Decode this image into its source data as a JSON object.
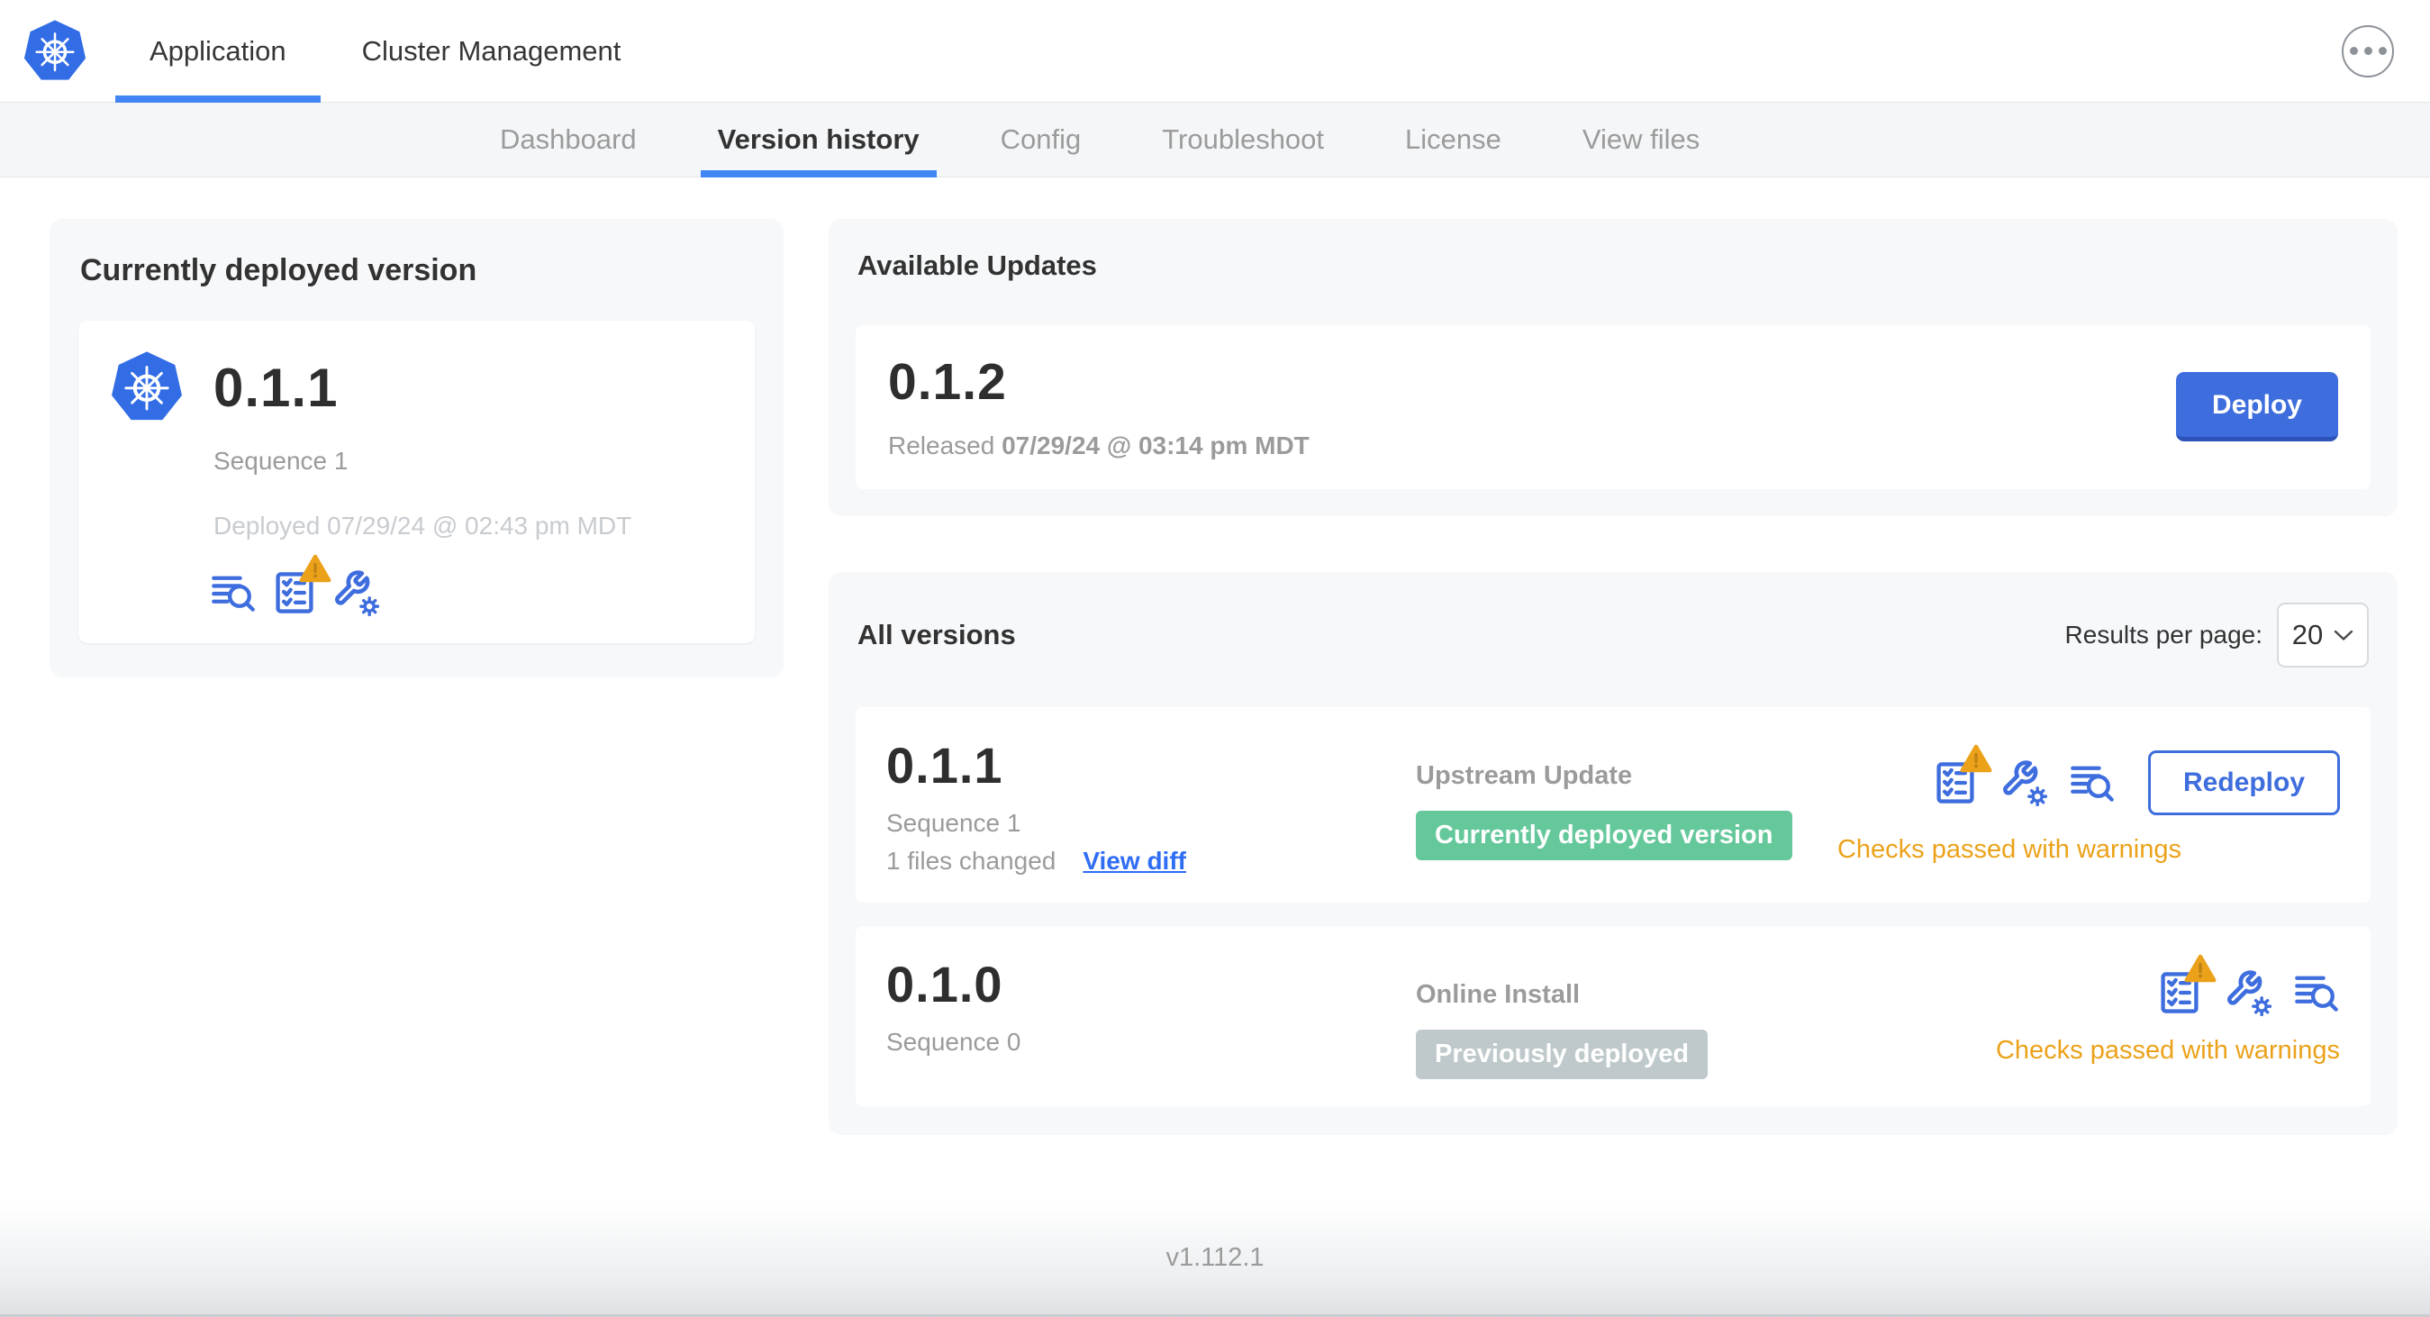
{
  "header": {
    "tabs": [
      {
        "label": "Application"
      },
      {
        "label": "Cluster Management"
      }
    ]
  },
  "subnav": {
    "tabs": [
      {
        "label": "Dashboard"
      },
      {
        "label": "Version history"
      },
      {
        "label": "Config"
      },
      {
        "label": "Troubleshoot"
      },
      {
        "label": "License"
      },
      {
        "label": "View files"
      }
    ]
  },
  "current_version": {
    "title": "Currently deployed version",
    "version": "0.1.1",
    "sequence": "Sequence 1",
    "deployed": "Deployed 07/29/24 @ 02:43 pm MDT"
  },
  "available_updates": {
    "title": "Available Updates",
    "version": "0.1.2",
    "released_label": "Released",
    "released_date": "07/29/24 @ 03:14 pm MDT",
    "deploy_label": "Deploy"
  },
  "all_versions": {
    "title": "All versions",
    "results_per_page_label": "Results per page:",
    "results_per_page": "20",
    "rows": [
      {
        "version": "0.1.1",
        "sequence": "Sequence 1",
        "files_changed": "1 files changed",
        "view_diff_label": "View diff",
        "source": "Upstream Update",
        "badge": "Currently deployed version",
        "status": "Checks passed with warnings",
        "action_label": "Redeploy"
      },
      {
        "version": "0.1.0",
        "sequence": "Sequence 0",
        "source": "Online Install",
        "badge": "Previously deployed",
        "status": "Checks passed with warnings"
      }
    ]
  },
  "footer": {
    "app_version": "v1.112.1"
  },
  "colors": {
    "accent_blue": "#3e6dde",
    "active_tab_underline": "#4285f4",
    "k8s_logo_blue": "#326de6",
    "badge_green_bg": "#65c89b",
    "badge_gray_bg": "#bfc9cc",
    "warning_amber": "#eba21a",
    "text_dark": "#323232",
    "text_gray": "#9b9b9b",
    "card_bg": "#f6f8fa"
  }
}
